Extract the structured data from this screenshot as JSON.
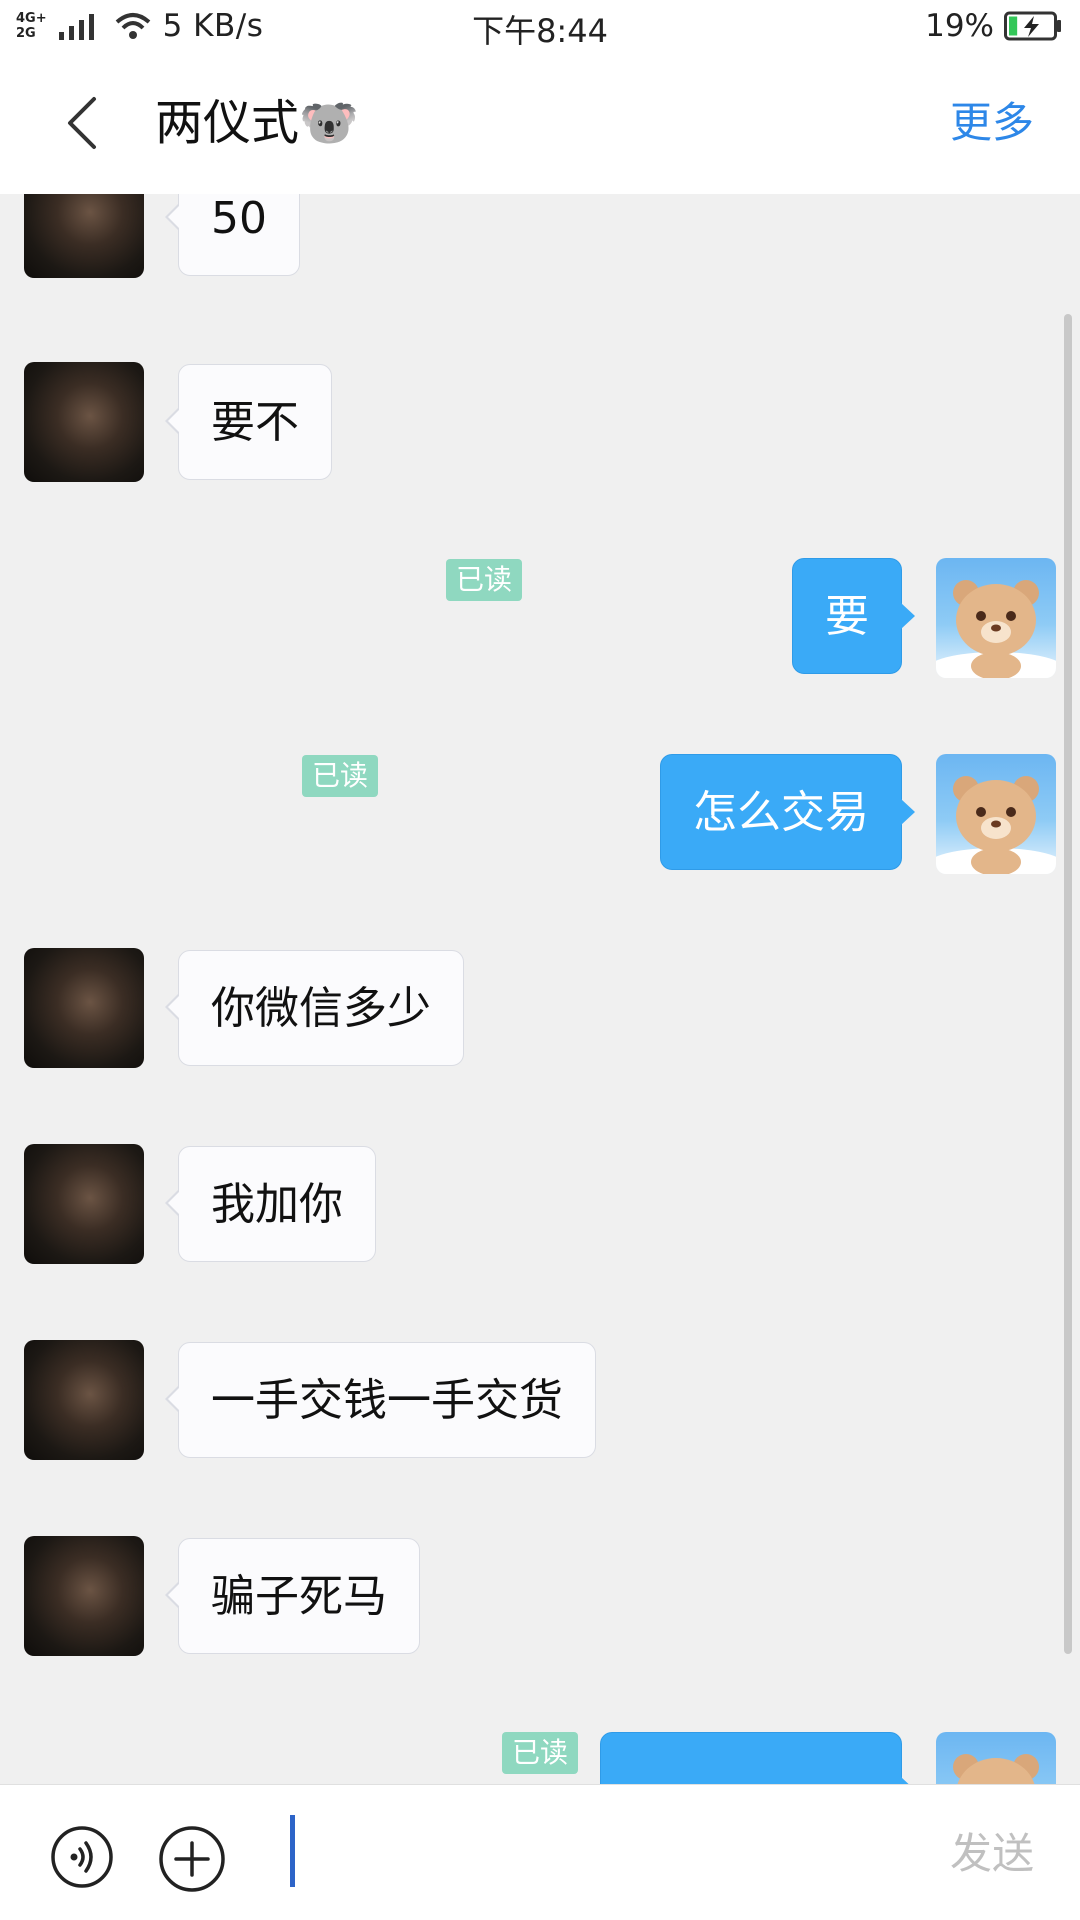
{
  "status_bar": {
    "net_type_top": "4G+",
    "net_type_bottom": "2G",
    "net_speed": "5 KB/s",
    "time": "下午8:44",
    "battery_percent": "19%",
    "battery_level": 0.19,
    "battery_charging": true
  },
  "header": {
    "title": "两仪式🐨",
    "more_label": "更多"
  },
  "messages": [
    {
      "dir": "in",
      "text": "50"
    },
    {
      "dir": "in",
      "text": "要不"
    },
    {
      "dir": "out",
      "text": "要",
      "status": "已读"
    },
    {
      "dir": "out",
      "text": "怎么交易",
      "status": "已读"
    },
    {
      "dir": "in",
      "text": "你微信多少"
    },
    {
      "dir": "in",
      "text": "我加你"
    },
    {
      "dir": "in",
      "text": "一手交钱一手交货"
    },
    {
      "dir": "in",
      "text": "骗子死马"
    },
    {
      "dir": "out",
      "text": "",
      "status": "已读"
    }
  ],
  "input_bar": {
    "input_value": "",
    "send_label": "发送"
  },
  "colors": {
    "accent": "#2d87e8",
    "outgoing_bubble": "#3aaaf7",
    "read_badge": "#8fd8c0",
    "background": "#f0f0f0"
  },
  "icons": {
    "back": "chevron-left-icon",
    "voice": "voice-icon",
    "plus": "plus-circle-icon",
    "wifi": "wifi-icon",
    "signal": "signal-icon",
    "battery": "battery-charging-icon"
  }
}
